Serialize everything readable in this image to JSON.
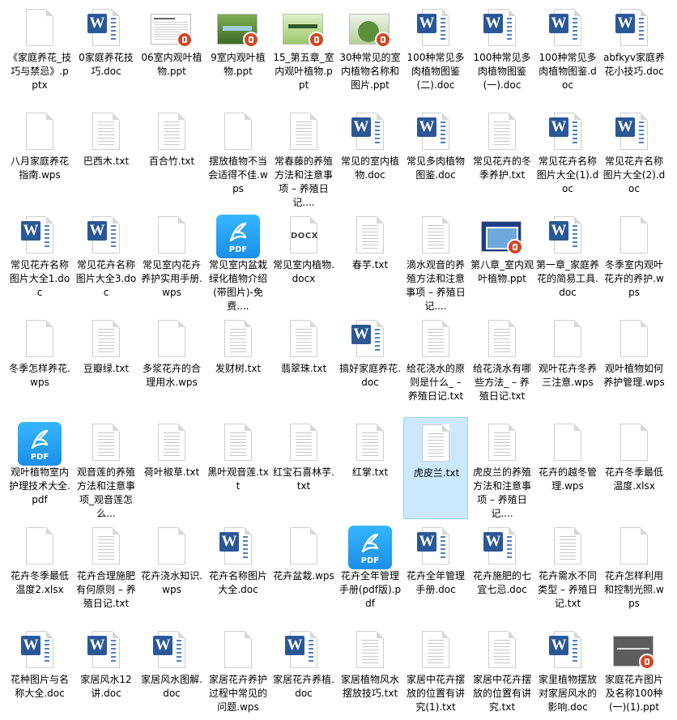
{
  "files": [
    {
      "name": "《家庭养花_技巧与禁忌》.pptx",
      "type": "blank"
    },
    {
      "name": "0家庭养花技巧.doc",
      "type": "word"
    },
    {
      "name": "06室内观叶植物.ppt",
      "type": "ppt",
      "thumb": "text"
    },
    {
      "name": "9室内观叶植物.ppt",
      "type": "ppt",
      "thumb": "photo"
    },
    {
      "name": "15_第五章_室内观叶植物.ppt",
      "type": "ppt",
      "thumb": "green"
    },
    {
      "name": "30种常见的室内植物名称和图片.ppt",
      "type": "ppt",
      "thumb": "plant"
    },
    {
      "name": "100种常见多肉植物图鉴(二).doc",
      "type": "word"
    },
    {
      "name": "100种常见多肉植物图鉴(一).doc",
      "type": "word"
    },
    {
      "name": "100种常见多肉植物图鉴.doc",
      "type": "word"
    },
    {
      "name": "abfkyv家庭养花小技巧.doc",
      "type": "word"
    },
    {
      "name": "八月家庭养花指南.wps",
      "type": "blank"
    },
    {
      "name": "巴西木.txt",
      "type": "txt"
    },
    {
      "name": "百合竹.txt",
      "type": "txt"
    },
    {
      "name": "摆放植物不当会适得不佳.wps",
      "type": "blank"
    },
    {
      "name": "常春藤的养殖方法和注意事项 – 养殖日记....",
      "type": "txt"
    },
    {
      "name": "常见的室内植物.doc",
      "type": "word"
    },
    {
      "name": "常见多肉植物图鉴.doc",
      "type": "word"
    },
    {
      "name": "常见花卉的冬季养护.txt",
      "type": "txt"
    },
    {
      "name": "常见花卉名称图片大全(1).doc",
      "type": "word"
    },
    {
      "name": "常见花卉名称图片大全(2).doc",
      "type": "word"
    },
    {
      "name": "常见花卉名称图片大全1.doc",
      "type": "word"
    },
    {
      "name": "常见花卉名称图片大全3.doc",
      "type": "word"
    },
    {
      "name": "常见室内花卉养护实用手册.wps",
      "type": "blank"
    },
    {
      "name": "常见室内盆栽绿化植物介绍(带图片)-免费....",
      "type": "pdf"
    },
    {
      "name": "常见室内植物.docx",
      "type": "docx"
    },
    {
      "name": "春芋.txt",
      "type": "txt"
    },
    {
      "name": "滴水观音的养殖方法和注意事项 – 养殖日记....",
      "type": "txt"
    },
    {
      "name": "第八章_室内观叶植物.ppt",
      "type": "ppt",
      "thumb": "blue"
    },
    {
      "name": "第一章_家庭养花的简易工具.doc",
      "type": "word"
    },
    {
      "name": "冬季室内观叶花卉的养护.wps",
      "type": "blank"
    },
    {
      "name": "冬季怎样养花.wps",
      "type": "blank"
    },
    {
      "name": "豆瓣绿.txt",
      "type": "txt"
    },
    {
      "name": "多浆花卉的合理用水.wps",
      "type": "blank"
    },
    {
      "name": "发财树.txt",
      "type": "txt"
    },
    {
      "name": "翡翠珠.txt",
      "type": "txt"
    },
    {
      "name": "搞好家庭养花.doc",
      "type": "word"
    },
    {
      "name": "给花浇水的原则是什么_ – 养殖日记.txt",
      "type": "txt"
    },
    {
      "name": "给花浇水有哪些方法_ – 养殖日记.txt",
      "type": "txt"
    },
    {
      "name": "观叶花卉冬养三注意.wps",
      "type": "blank"
    },
    {
      "name": "观叶植物如何养护管理.wps",
      "type": "blank"
    },
    {
      "name": "观叶植物室内护理技术大全.pdf",
      "type": "pdf"
    },
    {
      "name": "观音莲的养殖方法和注意事项_观音莲怎么...",
      "type": "txt"
    },
    {
      "name": "荷叶椒草.txt",
      "type": "txt"
    },
    {
      "name": "黑叶观音莲.txt",
      "type": "txt"
    },
    {
      "name": "红宝石喜林芋.txt",
      "type": "txt"
    },
    {
      "name": "红掌.txt",
      "type": "txt"
    },
    {
      "name": "虎皮兰.txt",
      "type": "txt",
      "selected": true
    },
    {
      "name": "虎皮兰的养殖方法和注意事项 – 养殖日记....",
      "type": "txt"
    },
    {
      "name": "花卉的越冬管理.wps",
      "type": "blank"
    },
    {
      "name": "花卉冬季最低温度.xlsx",
      "type": "blank"
    },
    {
      "name": "花卉冬季最低温度2.xlsx",
      "type": "blank"
    },
    {
      "name": "花卉合理施肥有何原则 – 养殖日记.txt",
      "type": "txt"
    },
    {
      "name": "花卉浇水知识.wps",
      "type": "blank"
    },
    {
      "name": "花卉名称图片大全.doc",
      "type": "word"
    },
    {
      "name": "花卉盆栽.wps",
      "type": "blank"
    },
    {
      "name": "花卉全年管理手册(pdf版).pdf",
      "type": "pdf"
    },
    {
      "name": "花卉全年管理手册.doc",
      "type": "word"
    },
    {
      "name": "花卉施肥的七宜七忌.doc",
      "type": "word"
    },
    {
      "name": "花卉需水不同类型 – 养殖日记.txt",
      "type": "txt"
    },
    {
      "name": "花卉怎样利用和控制光照.wps",
      "type": "blank"
    },
    {
      "name": "花种图片与名称大全.doc",
      "type": "word"
    },
    {
      "name": "家居风水12讲.doc",
      "type": "word"
    },
    {
      "name": "家居风水图解.doc",
      "type": "word"
    },
    {
      "name": "家居花卉养护过程中常见的问题.wps",
      "type": "blank"
    },
    {
      "name": "家居花卉养植.doc",
      "type": "word"
    },
    {
      "name": "家居植物风水摆放技巧.txt",
      "type": "txt"
    },
    {
      "name": "家居中花卉摆放的位置有讲究(1).txt",
      "type": "txt"
    },
    {
      "name": "家居中花卉摆放的位置有讲究.txt",
      "type": "txt"
    },
    {
      "name": "家里植物摆放对家居风水的影响.doc",
      "type": "word"
    },
    {
      "name": "家庭花卉图片及名称100种(一)(1).ppt",
      "type": "ppt",
      "thumb": "gray"
    }
  ],
  "pdf_label": "PDF",
  "docx_label": "DOCX",
  "word_letter": "W"
}
